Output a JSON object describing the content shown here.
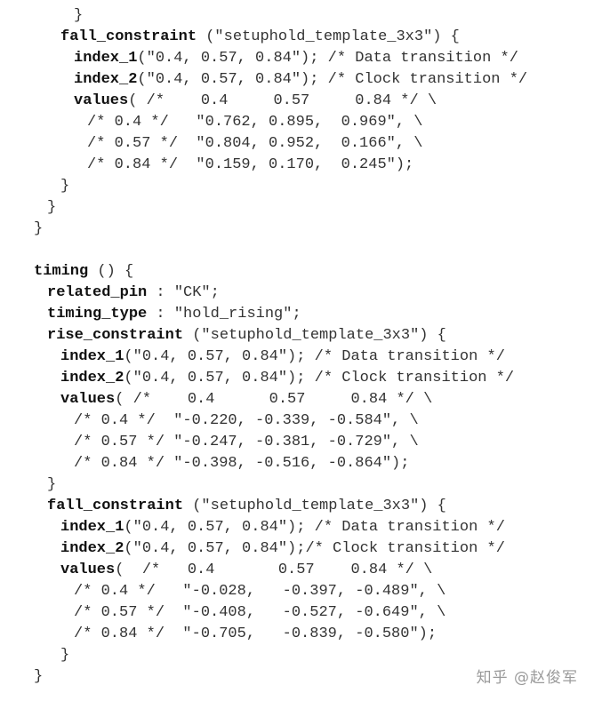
{
  "code_lines": [
    {
      "indent": 3,
      "segments": [
        {
          "text": "}",
          "bold": false
        }
      ]
    },
    {
      "indent": 2,
      "segments": [
        {
          "text": "fall_constraint",
          "bold": true
        },
        {
          "text": " (\"setuphold_template_3x3\") {",
          "bold": false
        }
      ]
    },
    {
      "indent": 3,
      "segments": [
        {
          "text": "index_1",
          "bold": true
        },
        {
          "text": "(\"0.4, 0.57, 0.84\"); /* Data transition */",
          "bold": false
        }
      ]
    },
    {
      "indent": 3,
      "segments": [
        {
          "text": "index_2",
          "bold": true
        },
        {
          "text": "(\"0.4, 0.57, 0.84\"); /* Clock transition */",
          "bold": false
        }
      ]
    },
    {
      "indent": 3,
      "segments": [
        {
          "text": "values",
          "bold": true
        },
        {
          "text": "( /*    0.4     0.57     0.84 */ \\",
          "bold": false
        }
      ]
    },
    {
      "indent": 4,
      "segments": [
        {
          "text": "/* 0.4 */   \"0.762, 0.895,  0.969\", \\",
          "bold": false
        }
      ]
    },
    {
      "indent": 4,
      "segments": [
        {
          "text": "/* 0.57 */  \"0.804, 0.952,  0.166\", \\",
          "bold": false
        }
      ]
    },
    {
      "indent": 4,
      "segments": [
        {
          "text": "/* 0.84 */  \"0.159, 0.170,  0.245\");",
          "bold": false
        }
      ]
    },
    {
      "indent": 2,
      "segments": [
        {
          "text": "}",
          "bold": false
        }
      ]
    },
    {
      "indent": 1,
      "segments": [
        {
          "text": "}",
          "bold": false
        }
      ]
    },
    {
      "indent": 0,
      "segments": [
        {
          "text": "}",
          "bold": false
        }
      ]
    },
    {
      "indent": -1,
      "segments": []
    },
    {
      "indent": 0,
      "segments": [
        {
          "text": "timing",
          "bold": true
        },
        {
          "text": " () {",
          "bold": false
        }
      ]
    },
    {
      "indent": 1,
      "segments": [
        {
          "text": "related_pin",
          "bold": true
        },
        {
          "text": " : ",
          "bold": false
        },
        {
          "text": "\"CK\";",
          "bold": false
        }
      ]
    },
    {
      "indent": 1,
      "segments": [
        {
          "text": "timing_type",
          "bold": true
        },
        {
          "text": " : ",
          "bold": false
        },
        {
          "text": "\"hold_rising\";",
          "bold": false
        }
      ]
    },
    {
      "indent": 1,
      "segments": [
        {
          "text": "rise_constraint",
          "bold": true
        },
        {
          "text": " (\"setuphold_template_3x3\") {",
          "bold": false
        }
      ]
    },
    {
      "indent": 2,
      "segments": [
        {
          "text": "index_1",
          "bold": true
        },
        {
          "text": "(\"0.4, 0.57, 0.84\"); /* Data transition */",
          "bold": false
        }
      ]
    },
    {
      "indent": 2,
      "segments": [
        {
          "text": "index_2",
          "bold": true
        },
        {
          "text": "(\"0.4, 0.57, 0.84\"); /* Clock transition */",
          "bold": false
        }
      ]
    },
    {
      "indent": 2,
      "segments": [
        {
          "text": "values",
          "bold": true
        },
        {
          "text": "( /*    0.4      0.57     0.84 */ \\",
          "bold": false
        }
      ]
    },
    {
      "indent": 3,
      "segments": [
        {
          "text": "/* 0.4 */  \"-0.220, -0.339, -0.584\", \\",
          "bold": false
        }
      ]
    },
    {
      "indent": 3,
      "segments": [
        {
          "text": "/* 0.57 */ \"-0.247, -0.381, -0.729\", \\",
          "bold": false
        }
      ]
    },
    {
      "indent": 3,
      "segments": [
        {
          "text": "/* 0.84 */ \"-0.398, -0.516, -0.864\");",
          "bold": false
        }
      ]
    },
    {
      "indent": 1,
      "segments": [
        {
          "text": "}",
          "bold": false
        }
      ]
    },
    {
      "indent": 1,
      "segments": [
        {
          "text": "fall_constraint",
          "bold": true
        },
        {
          "text": " (\"setuphold_template_3x3\") {",
          "bold": false
        }
      ]
    },
    {
      "indent": 2,
      "segments": [
        {
          "text": "index_1",
          "bold": true
        },
        {
          "text": "(\"0.4, 0.57, 0.84\"); /* Data transition */",
          "bold": false
        }
      ]
    },
    {
      "indent": 2,
      "segments": [
        {
          "text": "index_2",
          "bold": true
        },
        {
          "text": "(\"0.4, 0.57, 0.84\");/* Clock transition */",
          "bold": false
        }
      ]
    },
    {
      "indent": 2,
      "segments": [
        {
          "text": "values",
          "bold": true
        },
        {
          "text": "(  /*   0.4       0.57    0.84 */ \\",
          "bold": false
        }
      ]
    },
    {
      "indent": 3,
      "segments": [
        {
          "text": "/* 0.4 */   \"-0.028,   -0.397, -0.489\", \\",
          "bold": false
        }
      ]
    },
    {
      "indent": 3,
      "segments": [
        {
          "text": "/* 0.57 */  \"-0.408,   -0.527, -0.649\", \\",
          "bold": false
        }
      ]
    },
    {
      "indent": 3,
      "segments": [
        {
          "text": "/* 0.84 */  \"-0.705,   -0.839, -0.580\");",
          "bold": false
        }
      ]
    },
    {
      "indent": 2,
      "segments": [
        {
          "text": "}",
          "bold": false
        }
      ]
    },
    {
      "indent": 0,
      "segments": [
        {
          "text": "}",
          "bold": false
        }
      ]
    }
  ],
  "watermark": "知乎 @赵俊军"
}
